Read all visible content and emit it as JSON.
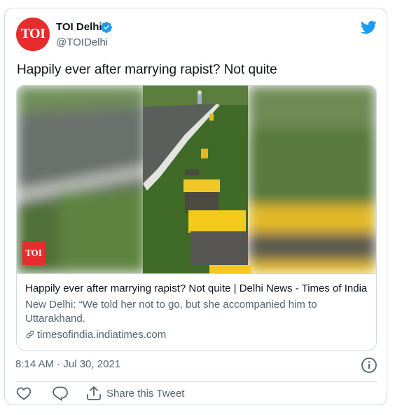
{
  "account": {
    "display_name": "TOI Delhi",
    "handle": "@TOIDelhi",
    "avatar_text": "TOI"
  },
  "tweet": {
    "text": "Happily ever after marrying rapist? Not quite",
    "timestamp": "8:14 AM · Jul 30, 2021"
  },
  "link_card": {
    "badge_text": "TOI",
    "title": "Happily ever after marrying rapist? Not quite | Delhi News - Times of India",
    "description": "New Delhi: “We told her not to go, but she accompanied him to Uttarakhand.",
    "domain": "timesofindia.indiatimes.com"
  },
  "actions": {
    "share_label": "Share this Tweet"
  },
  "icons": {
    "verified": "verified-badge-icon",
    "twitter": "twitter-bird-icon",
    "link": "link-icon",
    "info": "info-icon",
    "like": "heart-icon",
    "reply": "reply-icon",
    "share": "share-icon"
  },
  "colors": {
    "brand_blue": "#1d9bf0",
    "toi_red": "#e62d2d",
    "text_primary": "#0f1419",
    "text_secondary": "#536471",
    "border": "#cfd9de"
  }
}
